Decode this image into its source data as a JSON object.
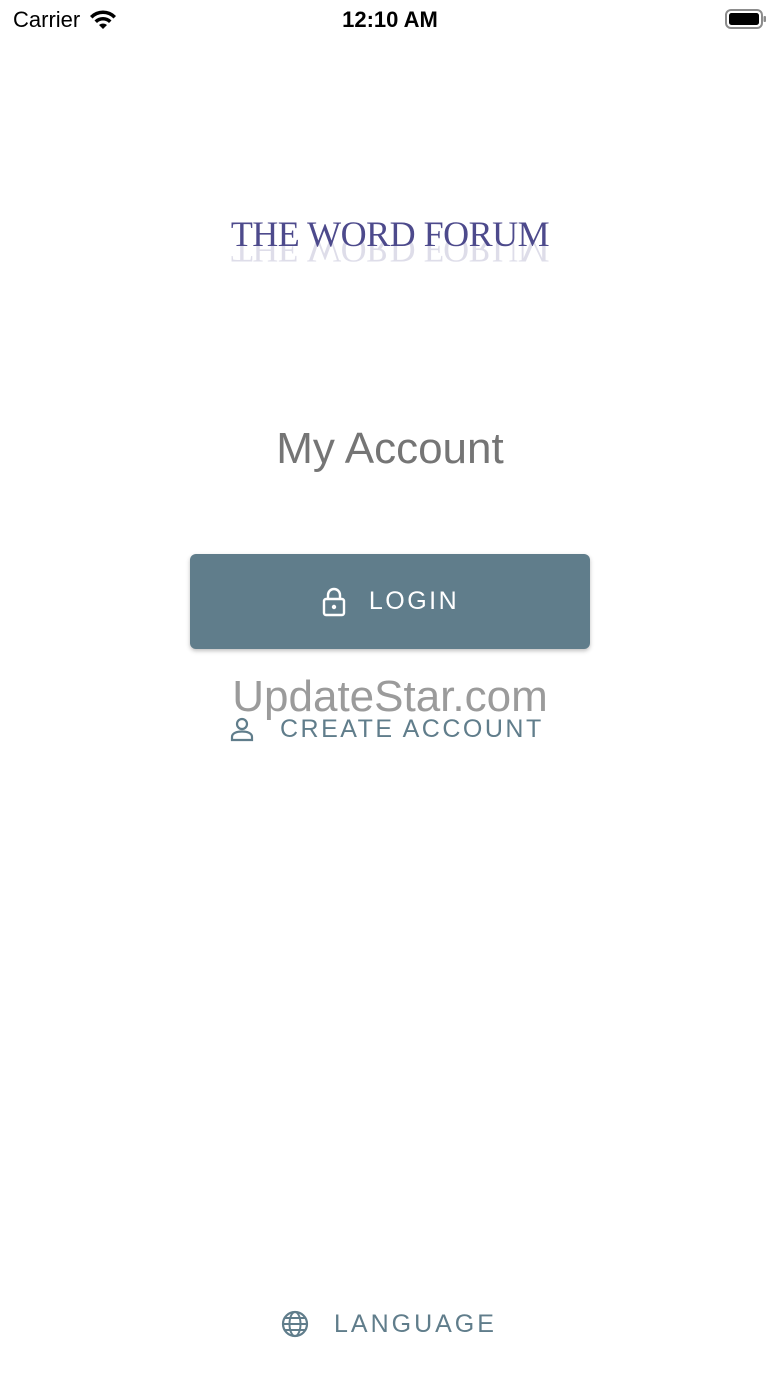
{
  "status_bar": {
    "carrier": "Carrier",
    "time": "12:10 AM"
  },
  "logo": {
    "text": "THE WORD FORUM",
    "color": "#4d4a8c"
  },
  "page": {
    "title": "My Account"
  },
  "buttons": {
    "login_label": "LOGIN",
    "login_icon": "lock-icon",
    "create_account_label": "CREATE ACCOUNT",
    "create_account_icon": "person-icon",
    "language_label": "LANGUAGE",
    "language_icon": "globe-icon"
  },
  "watermark": {
    "text": "UpdateStar.com"
  },
  "colors": {
    "accent": "#607d8b",
    "title_gray": "#757575"
  }
}
